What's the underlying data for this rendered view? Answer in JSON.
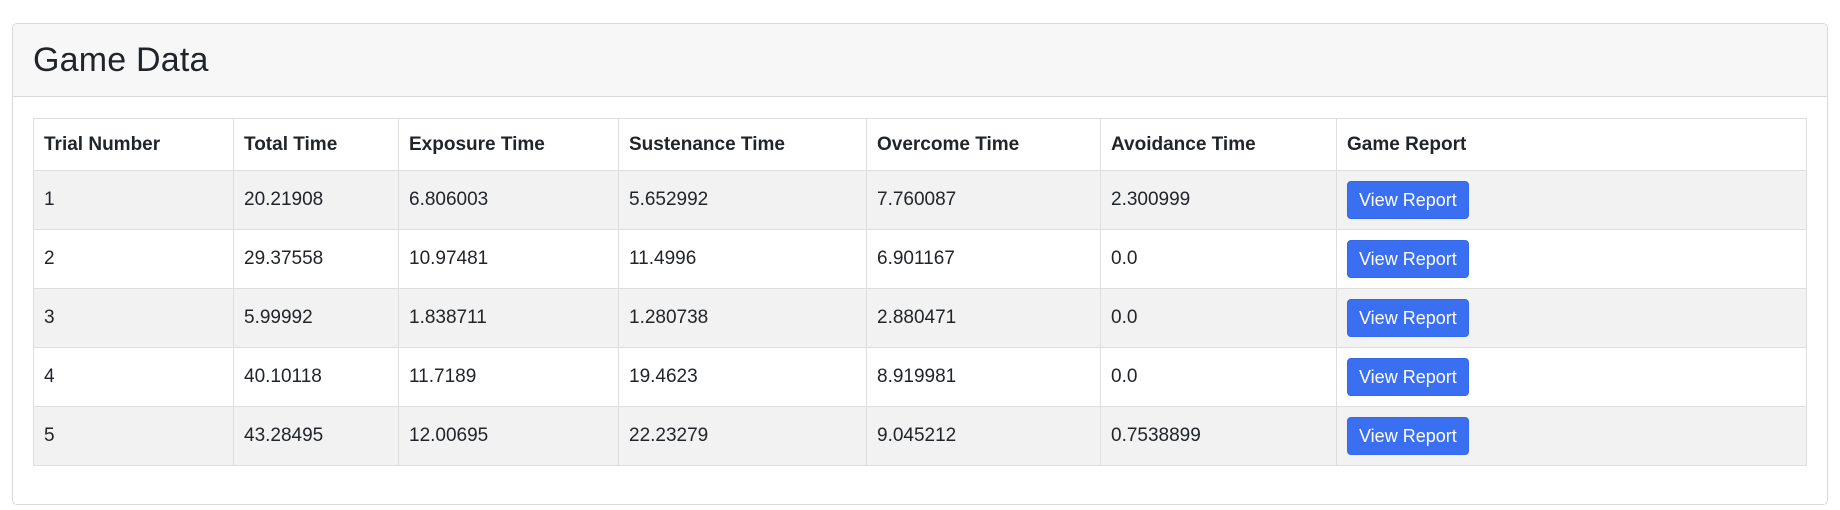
{
  "card": {
    "title": "Game Data"
  },
  "table": {
    "headers": [
      "Trial Number",
      "Total Time",
      "Exposure Time",
      "Sustenance Time",
      "Overcome Time",
      "Avoidance Time",
      "Game Report"
    ],
    "rows": [
      {
        "trial": "1",
        "total": "20.21908",
        "exposure": "6.806003",
        "sustenance": "5.652992",
        "overcome": "7.760087",
        "avoidance": "2.300999",
        "report_label": "View Report"
      },
      {
        "trial": "2",
        "total": "29.37558",
        "exposure": "10.97481",
        "sustenance": "11.4996",
        "overcome": "6.901167",
        "avoidance": "0.0",
        "report_label": "View Report"
      },
      {
        "trial": "3",
        "total": "5.99992",
        "exposure": "1.838711",
        "sustenance": "1.280738",
        "overcome": "2.880471",
        "avoidance": "0.0",
        "report_label": "View Report"
      },
      {
        "trial": "4",
        "total": "40.10118",
        "exposure": "11.7189",
        "sustenance": "19.4623",
        "overcome": "8.919981",
        "avoidance": "0.0",
        "report_label": "View Report"
      },
      {
        "trial": "5",
        "total": "43.28495",
        "exposure": "12.00695",
        "sustenance": "22.23279",
        "overcome": "9.045212",
        "avoidance": "0.7538899",
        "report_label": "View Report"
      }
    ]
  },
  "colors": {
    "button_primary": "#3a6ff2",
    "striped_row": "#f2f2f2",
    "header_bg": "#f7f7f7"
  }
}
